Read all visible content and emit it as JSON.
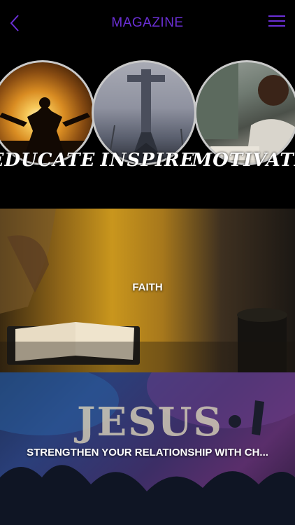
{
  "header": {
    "title": "MAGAZINE",
    "back_icon": "chevron-left-icon",
    "menu_icon": "hamburger-menu-icon",
    "accent_color": "#6b2fd6"
  },
  "categories": [
    {
      "label": "EDUCATE"
    },
    {
      "label": "INSPIRE"
    },
    {
      "label": "MOTIVATE"
    }
  ],
  "cards": [
    {
      "label": "FAITH"
    },
    {
      "label": "STRENGTHEN YOUR RELATIONSHIP WITH CH...",
      "overlay_text": "JESUS"
    }
  ]
}
